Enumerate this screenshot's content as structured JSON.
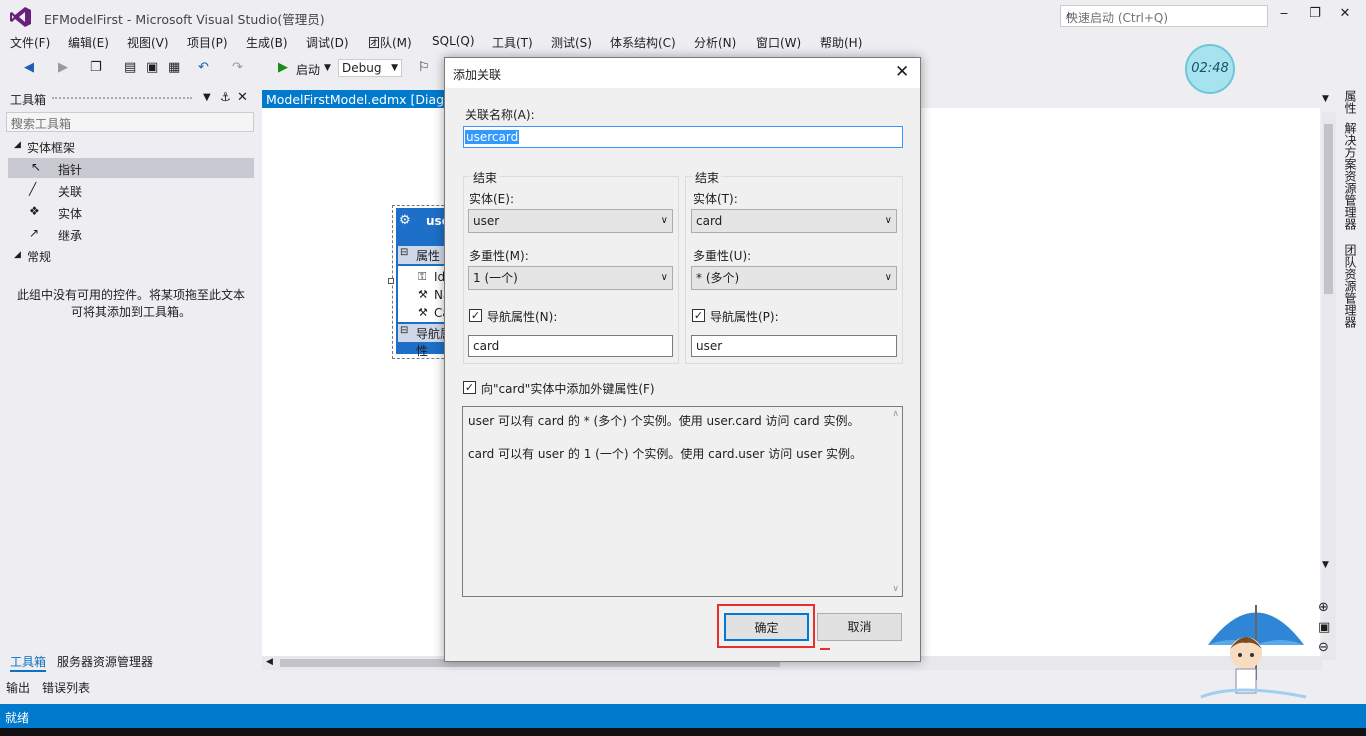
{
  "window": {
    "title": "EFModelFirst - Microsoft Visual Studio(管理员)",
    "quick_launch_placeholder": "快速启动 (Ctrl+Q)"
  },
  "menu": [
    "文件(F)",
    "编辑(E)",
    "视图(V)",
    "项目(P)",
    "生成(B)",
    "调试(D)",
    "团队(M)",
    "SQL(Q)",
    "工具(T)",
    "测试(S)",
    "体系结构(C)",
    "分析(N)",
    "窗口(W)",
    "帮助(H)"
  ],
  "toolbar": {
    "start_label": "启动",
    "config_value": "Debug"
  },
  "clock": "02:48",
  "toolbox": {
    "title": "工具箱",
    "search_placeholder": "搜索工具箱",
    "group1": "实体框架",
    "items": [
      "指针",
      "关联",
      "实体",
      "继承"
    ],
    "group2": "常规",
    "empty_hint": "此组中没有可用的控件。将某项拖至此文本可将其添加到工具箱。"
  },
  "bottom_tabs": {
    "toolbox": "工具箱",
    "server_explorer": "服务器资源管理器",
    "output": "输出",
    "error_list": "错误列表"
  },
  "document": {
    "tab": "ModelFirstModel.edmx [Diagram1]",
    "entity_name": "user",
    "properties_header": "属性",
    "properties": [
      "Id",
      "Na",
      "Ca"
    ],
    "nav_header": "导航属性"
  },
  "right_strip": [
    "属性",
    "解决方案资源管理器",
    "团队资源管理器"
  ],
  "status": "就绪",
  "dialog": {
    "title": "添加关联",
    "name_label": "关联名称(A):",
    "name_value": "usercard",
    "end_label": "结束",
    "left": {
      "entity_label": "实体(E):",
      "entity_value": "user",
      "multiplicity_label": "多重性(M):",
      "multiplicity_value": "1 (一个)",
      "nav_label": "导航属性(N):",
      "nav_value": "card"
    },
    "right": {
      "entity_label": "实体(T):",
      "entity_value": "card",
      "multiplicity_label": "多重性(U):",
      "multiplicity_value": "* (多个)",
      "nav_label": "导航属性(P):",
      "nav_value": "user"
    },
    "fk_label": "向\"card\"实体中添加外键属性(F)",
    "desc_line1": "user 可以有 card 的 * (多个) 个实例。使用 user.card 访问 card 实例。",
    "desc_line2": "card 可以有 user 的 1 (一个) 个实例。使用 card.user 访问 user 实例。",
    "ok": "确定",
    "cancel": "取消"
  }
}
